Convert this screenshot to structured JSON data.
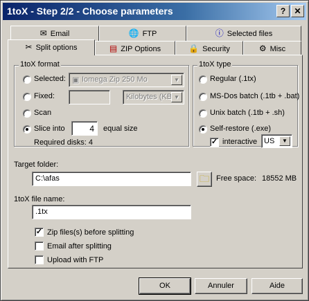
{
  "window": {
    "title": "1toX - Step 2/2 - Choose parameters",
    "help_button": "?",
    "close_button": "✕"
  },
  "tabs_row1": [
    {
      "label": "Email",
      "icon": "email-icon"
    },
    {
      "label": "FTP",
      "icon": "globe-icon"
    },
    {
      "label": "Selected files",
      "icon": "info-icon"
    }
  ],
  "tabs_row2": [
    {
      "label": "Split options",
      "icon": "split-icon",
      "active": true
    },
    {
      "label": "ZIP Options",
      "icon": "zip-icon"
    },
    {
      "label": "Security",
      "icon": "lock-icon"
    },
    {
      "label": "Misc",
      "icon": "gear-icon"
    }
  ],
  "format_group": {
    "title": "1toX format",
    "selected_label": "Selected:",
    "selected_value": "Iomega Zip 250 Mo",
    "fixed_label": "Fixed:",
    "fixed_value": "",
    "fixed_unit": "Kilobytes (KB",
    "scan_label": "Scan",
    "slice_label": "Slice into",
    "slice_value": "4",
    "slice_suffix": "equal size",
    "required_disks": "Required disks: 4",
    "checked": "slice"
  },
  "type_group": {
    "title": "1toX type",
    "options": [
      "Regular (.1tx)",
      "MS-Dos batch (.1tb + .bat)",
      "Unix batch (.1tb + .sh)",
      "Self-restore (.exe)"
    ],
    "checked": "Self-restore (.exe)",
    "interactive_label": "interactive",
    "interactive_checked": true,
    "language": "US"
  },
  "target": {
    "label": "Target folder:",
    "value": "C:\\afas",
    "free_space_label": "Free space:",
    "free_space_value": "18552 MB"
  },
  "filename": {
    "label": "1toX file name:",
    "value": ".1tx"
  },
  "options": [
    {
      "label": "Zip files(s) before splitting",
      "checked": true
    },
    {
      "label": "Email after splitting",
      "checked": false
    },
    {
      "label": "Upload with FTP",
      "checked": false
    }
  ],
  "buttons": {
    "ok": "OK",
    "cancel": "Annuler",
    "help": "Aide"
  }
}
